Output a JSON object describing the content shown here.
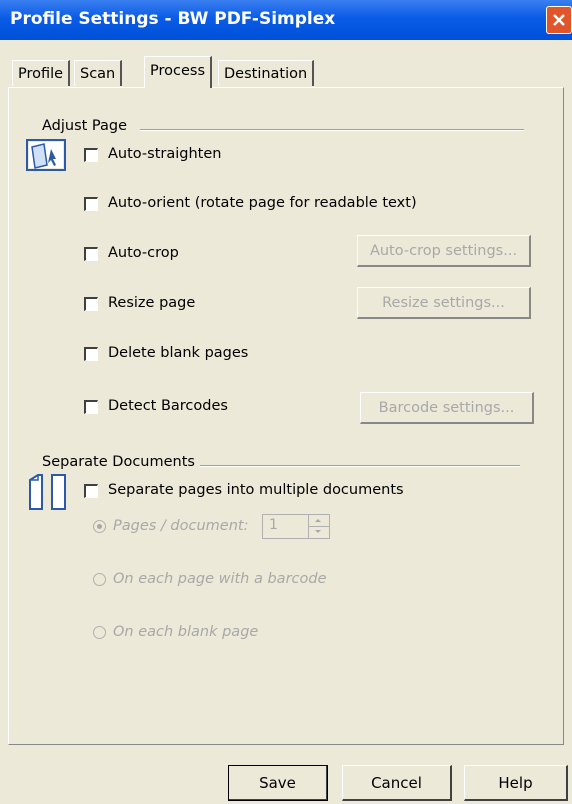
{
  "window": {
    "title": "Profile Settings - BW PDF-Simplex"
  },
  "tabs": [
    {
      "label": "Profile",
      "active": false
    },
    {
      "label": "Scan",
      "active": false
    },
    {
      "label": "Process",
      "active": true
    },
    {
      "label": "Destination",
      "active": false
    }
  ],
  "adjust_page": {
    "label": "Adjust Page",
    "options": {
      "auto_straighten": "Auto-straighten",
      "auto_orient": "Auto-orient (rotate page for readable text)",
      "auto_crop": "Auto-crop",
      "resize_page": "Resize page",
      "delete_blank": "Delete blank pages",
      "detect_barcodes": "Detect Barcodes"
    },
    "buttons": {
      "auto_crop_settings": "Auto-crop settings...",
      "resize_settings": "Resize settings...",
      "barcode_settings": "Barcode settings..."
    }
  },
  "separate_documents": {
    "label": "Separate Documents",
    "option": "Separate pages into multiple documents",
    "radios": {
      "pages_per_doc": "Pages / document:",
      "on_barcode": "On each page with a barcode",
      "on_blank": "On each blank page"
    },
    "pages_per_doc_value": "1"
  },
  "footer": {
    "save": "Save",
    "cancel": "Cancel",
    "help": "Help"
  }
}
